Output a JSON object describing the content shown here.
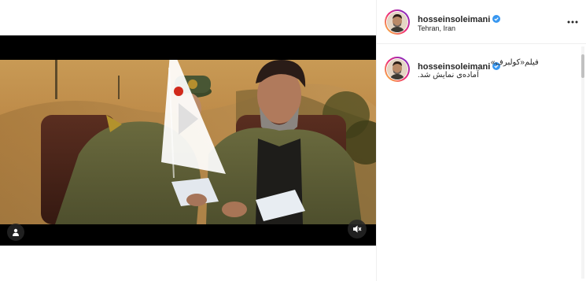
{
  "post": {
    "username": "hosseinsoleimani",
    "location": "Tehran, Iran",
    "verified": true
  },
  "caption": {
    "username": "hosseinsoleimani",
    "line1": "فیلم«کولبرف»",
    "line2": "آماده‌ی نمایش شد."
  },
  "media": {
    "type": "video",
    "muted": true
  },
  "icons": {
    "more": "more-options-icon",
    "verified": "verified-badge-icon",
    "user_tag": "user-tag-icon",
    "mute": "muted-speaker-icon",
    "play": "play-icon"
  },
  "colors": {
    "verified": "#3897f0",
    "text": "#262626",
    "media_background": "#000000",
    "divider": "#efefef"
  }
}
